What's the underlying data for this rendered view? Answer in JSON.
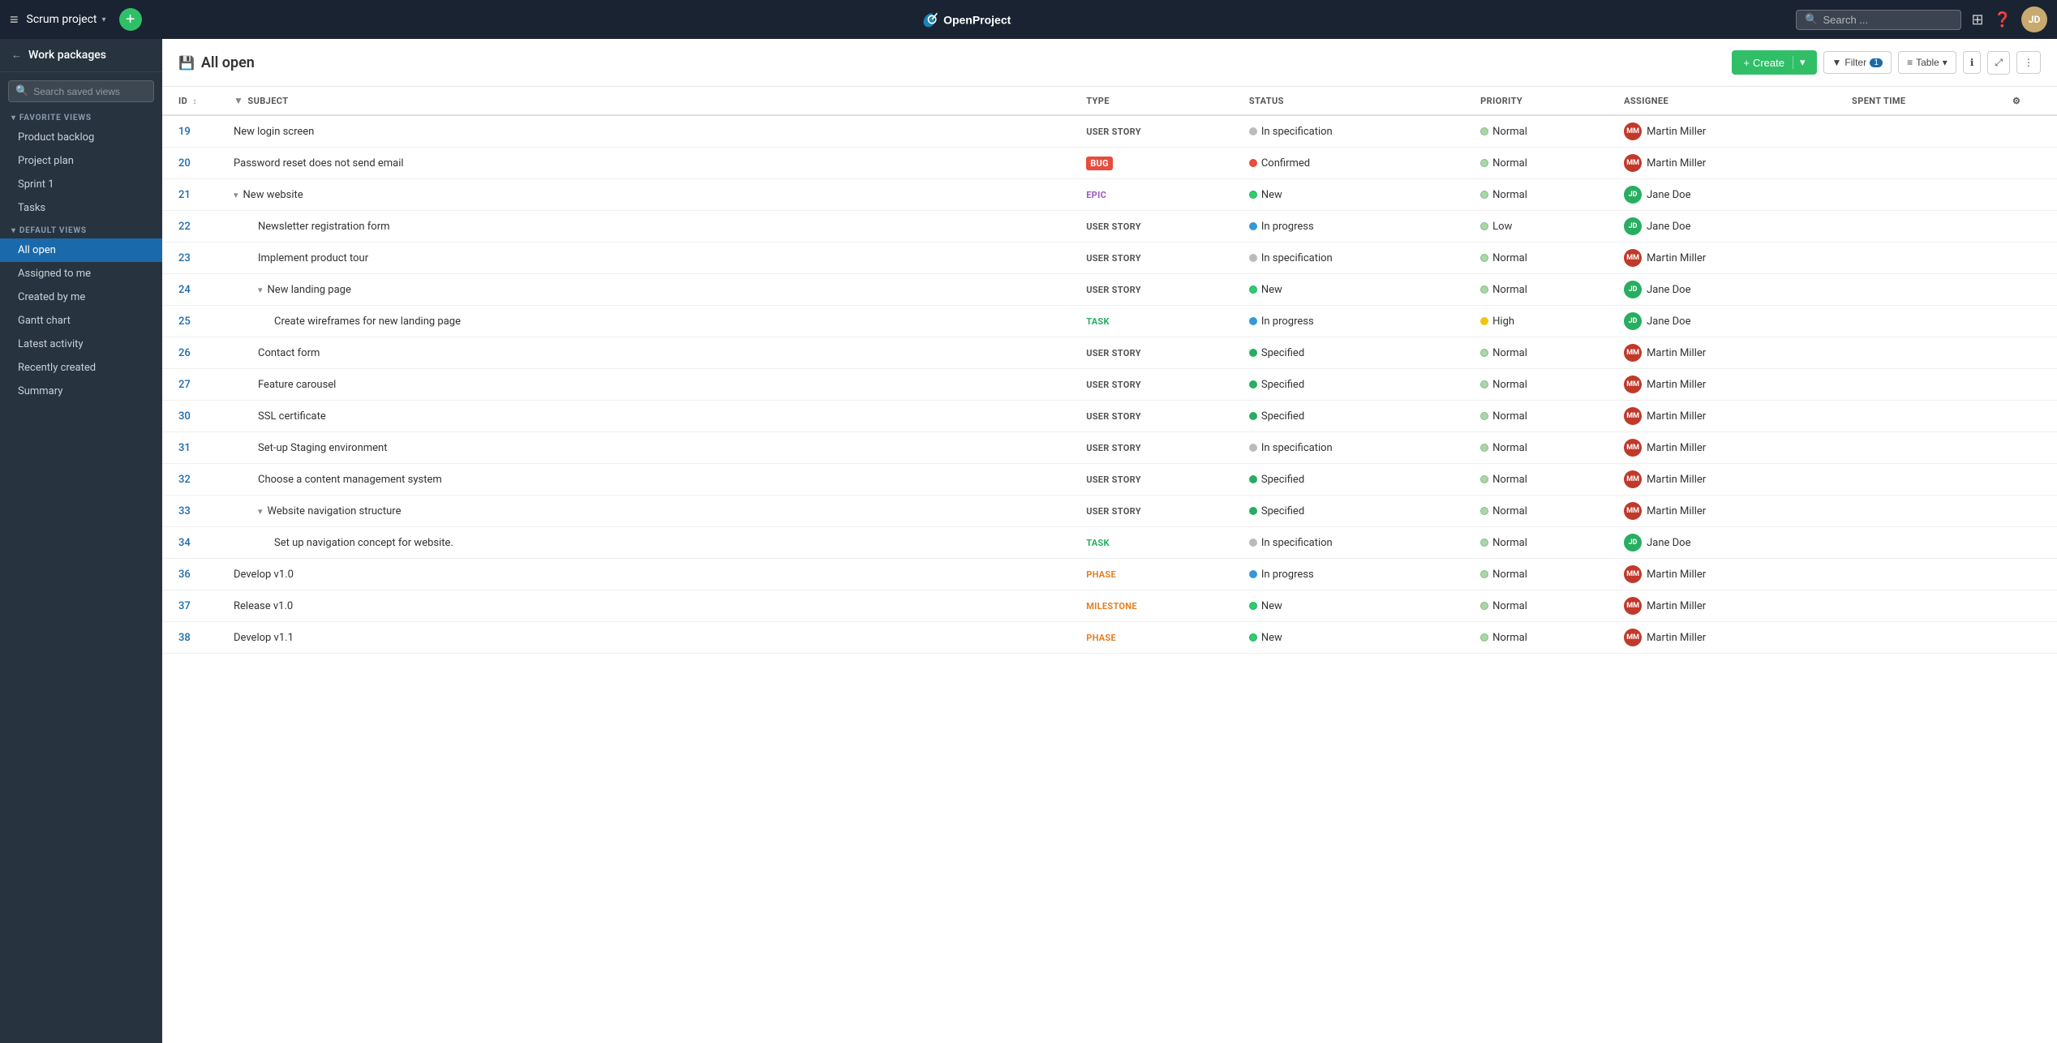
{
  "app": {
    "name": "OpenProject"
  },
  "topnav": {
    "hamburger": "≡",
    "project_name": "Scrum project",
    "project_arrow": "▾",
    "add_btn": "+",
    "search_placeholder": "Search ...",
    "nav_icons": [
      "grid",
      "help",
      "user"
    ],
    "user_initials": "JD"
  },
  "sidebar": {
    "back_label": "←",
    "title": "Work packages",
    "search_placeholder": "Search saved views",
    "favorite_section": "FAVORITE VIEWS",
    "favorite_items": [
      {
        "label": "Product backlog"
      },
      {
        "label": "Project plan"
      },
      {
        "label": "Sprint 1"
      },
      {
        "label": "Tasks"
      }
    ],
    "default_section": "DEFAULT VIEWS",
    "default_items": [
      {
        "label": "All open",
        "active": true
      },
      {
        "label": "Assigned to me"
      },
      {
        "label": "Created by me"
      },
      {
        "label": "Gantt chart"
      },
      {
        "label": "Latest activity"
      },
      {
        "label": "Recently created"
      },
      {
        "label": "Summary"
      }
    ]
  },
  "page": {
    "title": "All open",
    "title_icon": "💾",
    "create_btn": "+ Create",
    "filter_btn": "Filter",
    "filter_count": "1",
    "table_btn": "Table",
    "table_arrow": "▾"
  },
  "table": {
    "columns": [
      "ID",
      "SUBJECT",
      "TYPE",
      "STATUS",
      "PRIORITY",
      "ASSIGNEE",
      "SPENT TIME"
    ],
    "rows": [
      {
        "id": "19",
        "indent": 0,
        "collapse": false,
        "subject": "New login screen",
        "type": "USER STORY",
        "type_class": "type-user-story",
        "status_dot": "dot-gray",
        "status": "In specification",
        "priority_dot": "priority-normal",
        "priority": "Normal",
        "assignee_class": "av-mm",
        "assignee_initials": "MM",
        "assignee": "Martin Miller"
      },
      {
        "id": "20",
        "indent": 0,
        "collapse": false,
        "subject": "Password reset does not send email",
        "type": "BUG",
        "type_class": "type-bug",
        "status_dot": "dot-red",
        "status": "Confirmed",
        "priority_dot": "priority-normal",
        "priority": "Normal",
        "assignee_class": "av-mm",
        "assignee_initials": "MM",
        "assignee": "Martin Miller"
      },
      {
        "id": "21",
        "indent": 0,
        "collapse": true,
        "subject": "New website",
        "type": "EPIC",
        "type_class": "type-epic",
        "status_dot": "dot-teal",
        "status": "New",
        "priority_dot": "priority-normal",
        "priority": "Normal",
        "assignee_class": "av-jd",
        "assignee_initials": "JD",
        "assignee": "Jane Doe"
      },
      {
        "id": "22",
        "indent": 1,
        "collapse": false,
        "subject": "Newsletter registration form",
        "type": "USER STORY",
        "type_class": "type-user-story",
        "status_dot": "dot-blue",
        "status": "In progress",
        "priority_dot": "priority-low",
        "priority": "Low",
        "assignee_class": "av-jd",
        "assignee_initials": "JD",
        "assignee": "Jane Doe"
      },
      {
        "id": "23",
        "indent": 1,
        "collapse": false,
        "subject": "Implement product tour",
        "type": "USER STORY",
        "type_class": "type-user-story",
        "status_dot": "dot-gray",
        "status": "In specification",
        "priority_dot": "priority-normal",
        "priority": "Normal",
        "assignee_class": "av-mm",
        "assignee_initials": "MM",
        "assignee": "Martin Miller"
      },
      {
        "id": "24",
        "indent": 1,
        "collapse": true,
        "subject": "New landing page",
        "type": "USER STORY",
        "type_class": "type-user-story",
        "status_dot": "dot-teal",
        "status": "New",
        "priority_dot": "priority-normal",
        "priority": "Normal",
        "assignee_class": "av-jd",
        "assignee_initials": "JD",
        "assignee": "Jane Doe"
      },
      {
        "id": "25",
        "indent": 2,
        "collapse": false,
        "subject": "Create wireframes for new landing page",
        "type": "TASK",
        "type_class": "type-task",
        "status_dot": "dot-blue",
        "status": "In progress",
        "priority_dot": "priority-high",
        "priority": "High",
        "assignee_class": "av-jd",
        "assignee_initials": "JD",
        "assignee": "Jane Doe"
      },
      {
        "id": "26",
        "indent": 1,
        "collapse": false,
        "subject": "Contact form",
        "type": "USER STORY",
        "type_class": "type-user-story",
        "status_dot": "dot-green",
        "status": "Specified",
        "priority_dot": "priority-normal",
        "priority": "Normal",
        "assignee_class": "av-mm",
        "assignee_initials": "MM",
        "assignee": "Martin Miller"
      },
      {
        "id": "27",
        "indent": 1,
        "collapse": false,
        "subject": "Feature carousel",
        "type": "USER STORY",
        "type_class": "type-user-story",
        "status_dot": "dot-green",
        "status": "Specified",
        "priority_dot": "priority-normal",
        "priority": "Normal",
        "assignee_class": "av-mm",
        "assignee_initials": "MM",
        "assignee": "Martin Miller"
      },
      {
        "id": "30",
        "indent": 1,
        "collapse": false,
        "subject": "SSL certificate",
        "type": "USER STORY",
        "type_class": "type-user-story",
        "status_dot": "dot-green",
        "status": "Specified",
        "priority_dot": "priority-normal",
        "priority": "Normal",
        "assignee_class": "av-mm",
        "assignee_initials": "MM",
        "assignee": "Martin Miller"
      },
      {
        "id": "31",
        "indent": 1,
        "collapse": false,
        "subject": "Set-up Staging environment",
        "type": "USER STORY",
        "type_class": "type-user-story",
        "status_dot": "dot-gray",
        "status": "In specification",
        "priority_dot": "priority-normal",
        "priority": "Normal",
        "assignee_class": "av-mm",
        "assignee_initials": "MM",
        "assignee": "Martin Miller"
      },
      {
        "id": "32",
        "indent": 1,
        "collapse": false,
        "subject": "Choose a content management system",
        "type": "USER STORY",
        "type_class": "type-user-story",
        "status_dot": "dot-green",
        "status": "Specified",
        "priority_dot": "priority-normal",
        "priority": "Normal",
        "assignee_class": "av-mm",
        "assignee_initials": "MM",
        "assignee": "Martin Miller"
      },
      {
        "id": "33",
        "indent": 1,
        "collapse": true,
        "subject": "Website navigation structure",
        "type": "USER STORY",
        "type_class": "type-user-story",
        "status_dot": "dot-green",
        "status": "Specified",
        "priority_dot": "priority-normal",
        "priority": "Normal",
        "assignee_class": "av-mm",
        "assignee_initials": "MM",
        "assignee": "Martin Miller"
      },
      {
        "id": "34",
        "indent": 2,
        "collapse": false,
        "subject": "Set up navigation concept for website.",
        "type": "TASK",
        "type_class": "type-task",
        "status_dot": "dot-gray",
        "status": "In specification",
        "priority_dot": "priority-normal",
        "priority": "Normal",
        "assignee_class": "av-jd",
        "assignee_initials": "JD",
        "assignee": "Jane Doe"
      },
      {
        "id": "36",
        "indent": 0,
        "collapse": false,
        "subject": "Develop v1.0",
        "type": "PHASE",
        "type_class": "type-phase",
        "status_dot": "dot-blue",
        "status": "In progress",
        "priority_dot": "priority-normal",
        "priority": "Normal",
        "assignee_class": "av-mm",
        "assignee_initials": "MM",
        "assignee": "Martin Miller"
      },
      {
        "id": "37",
        "indent": 0,
        "collapse": false,
        "subject": "Release v1.0",
        "type": "MILESTONE",
        "type_class": "type-milestone",
        "status_dot": "dot-teal",
        "status": "New",
        "priority_dot": "priority-normal",
        "priority": "Normal",
        "assignee_class": "av-mm",
        "assignee_initials": "MM",
        "assignee": "Martin Miller"
      },
      {
        "id": "38",
        "indent": 0,
        "collapse": false,
        "subject": "Develop v1.1",
        "type": "PHASE",
        "type_class": "type-phase",
        "status_dot": "dot-teal",
        "status": "New",
        "priority_dot": "priority-normal",
        "priority": "Normal",
        "assignee_class": "av-mm",
        "assignee_initials": "MM",
        "assignee": "Martin Miller"
      }
    ]
  }
}
